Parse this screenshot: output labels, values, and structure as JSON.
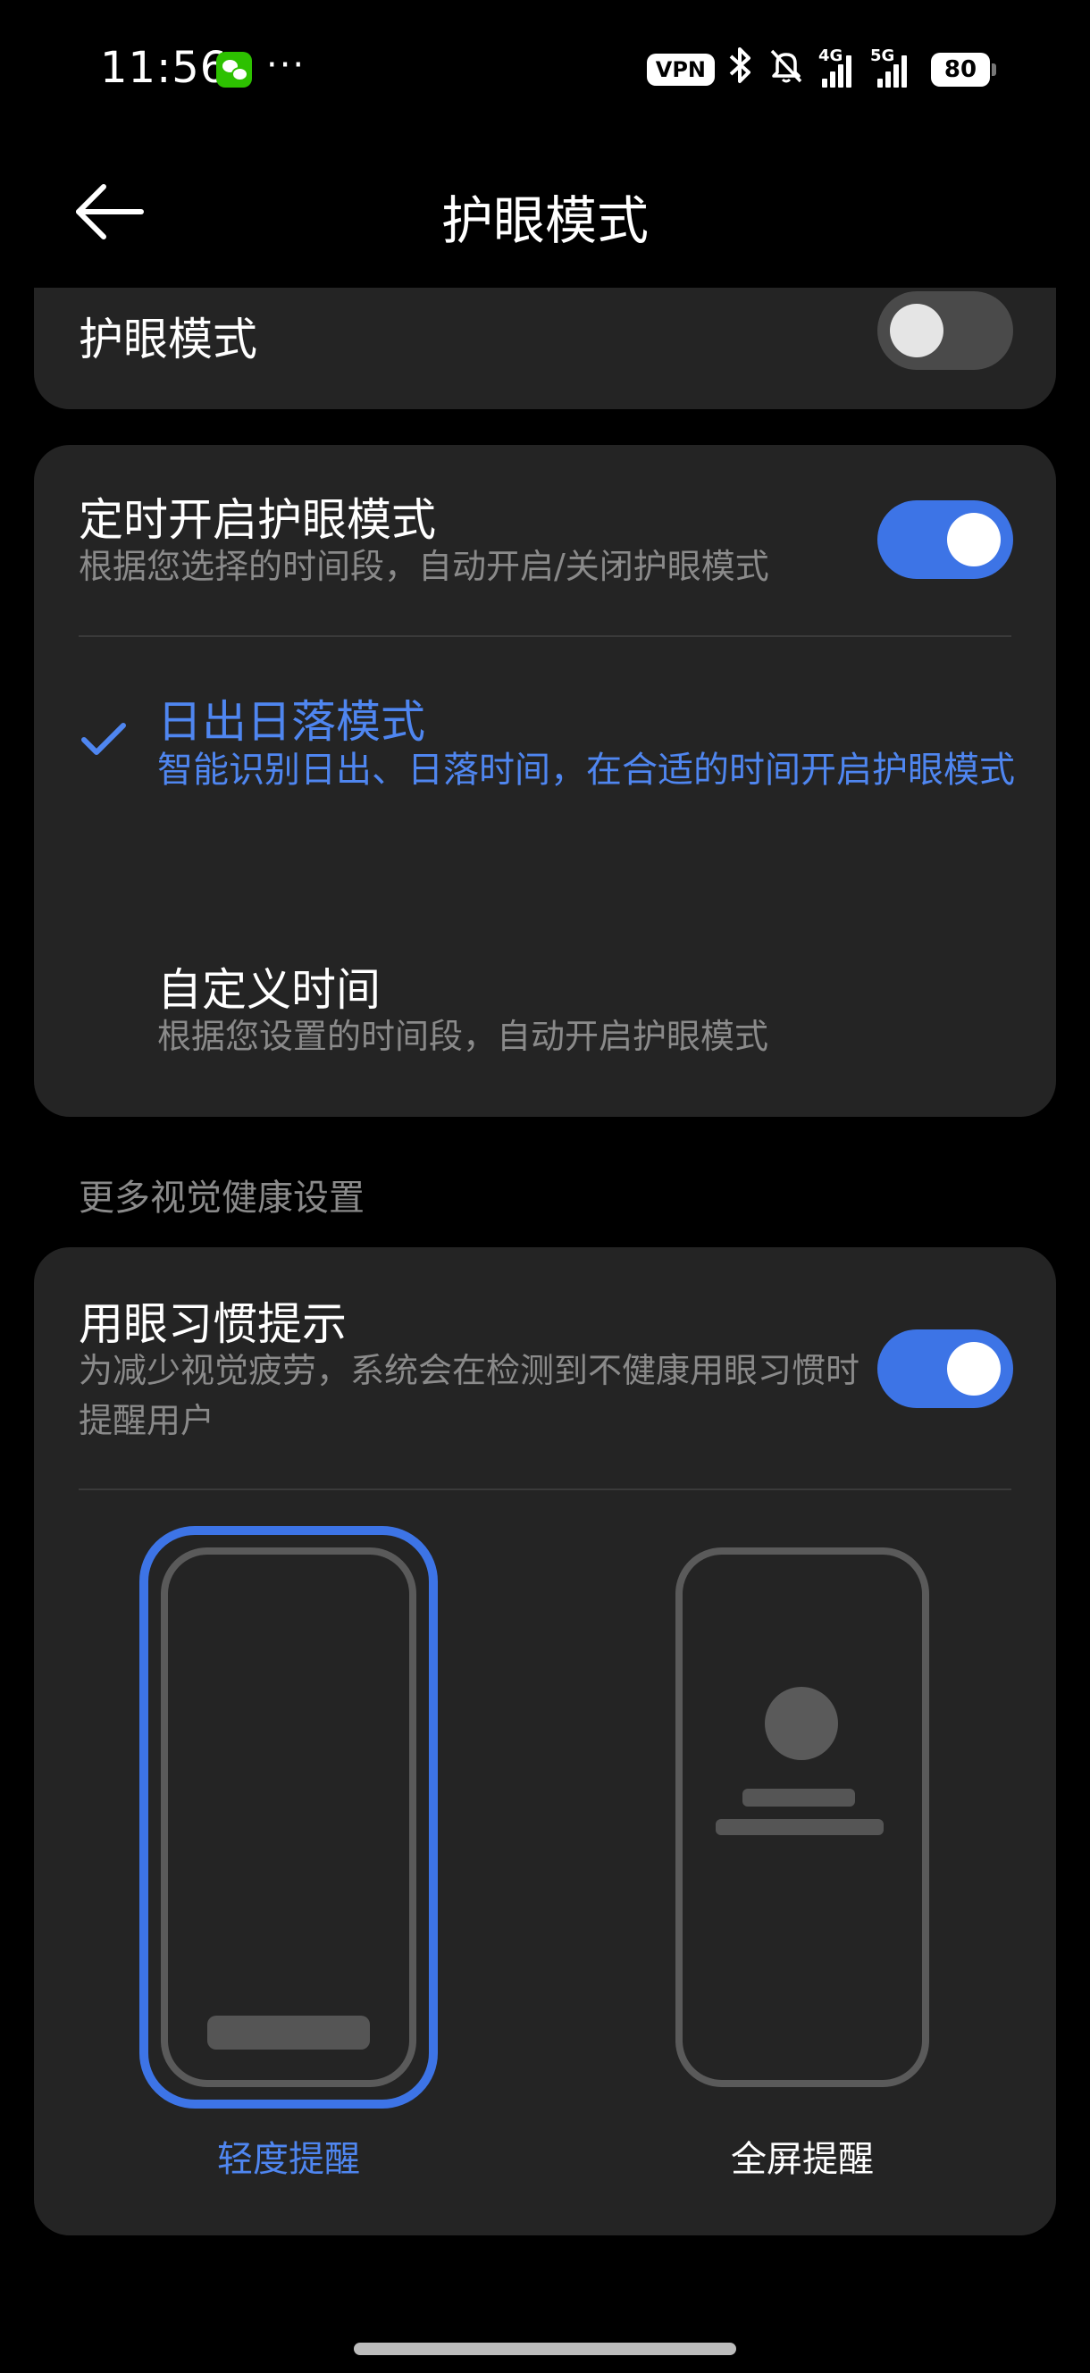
{
  "status_bar": {
    "time": "11:56",
    "more": "···",
    "vpn": "VPN",
    "signal_1_label": "4G",
    "signal_2_label": "5G",
    "battery": "80",
    "icons": [
      "wechat-icon",
      "bluetooth-icon",
      "mute-icon",
      "signal-icon",
      "battery-icon"
    ]
  },
  "header": {
    "title": "护眼模式",
    "back_icon": "arrow-left-icon"
  },
  "eye_mode_card": {
    "label": "护眼模式",
    "toggle_on": false
  },
  "schedule_card": {
    "title": "定时开启护眼模式",
    "subtitle": "根据您选择的时间段，自动开启/关闭护眼模式",
    "toggle_on": true,
    "options": [
      {
        "title": "日出日落模式",
        "subtitle": "智能识别日出、日落时间，在合适的时间开启护眼模式",
        "selected": true
      },
      {
        "title": "自定义时间",
        "subtitle": "根据您设置的时间段，自动开启护眼模式",
        "selected": false
      }
    ]
  },
  "section_label": "更多视觉健康设置",
  "habit_card": {
    "title": "用眼习惯提示",
    "subtitle": "为减少视觉疲劳，系统会在检测到不健康用眼习惯时提醒用户",
    "toggle_on": true,
    "styles": [
      {
        "label": "轻度提醒",
        "selected": true
      },
      {
        "label": "全屏提醒",
        "selected": false
      }
    ]
  },
  "colors": {
    "accent": "#3d74e6",
    "card_bg": "#242424",
    "page_bg": "#000000",
    "secondary_text": "#8a8a8a"
  }
}
